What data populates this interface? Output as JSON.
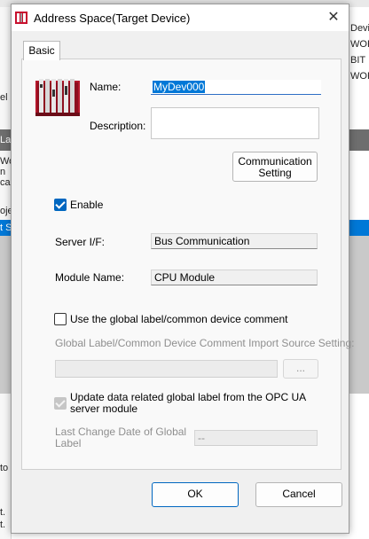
{
  "background": {
    "right_texts": [
      "Devi",
      "WOR",
      "BIT",
      "WOR"
    ],
    "left_texts": [
      "el (",
      "Lab",
      "Wor",
      "n",
      "ca",
      "oje",
      "t S",
      "to",
      "t.",
      "t."
    ]
  },
  "dialog": {
    "title": "Address Space(Target Device)",
    "close_glyph": "✕",
    "tab_label": "Basic",
    "name_label": "Name:",
    "name_value": "MyDev000",
    "description_label": "Description:",
    "description_value": "",
    "comm_button_line1": "Communication",
    "comm_button_line2": "Setting",
    "enable_label": "Enable",
    "enable_checked": true,
    "server_if_label": "Server I/F:",
    "server_if_value": "Bus Communication",
    "module_name_label": "Module Name:",
    "module_name_value": "CPU Module",
    "global_label_checkbox": "Use the global label/common device comment",
    "global_label_checked": false,
    "import_source_label": "Global Label/Common Device Comment Import Source Setting:",
    "import_source_value": "",
    "browse_label": "...",
    "update_label_line1": "Update data related global label from the OPC UA",
    "update_label_line2": "server module",
    "update_checked": true,
    "last_change_line1": "Last Change Date of Global",
    "last_change_line2": "Label",
    "last_change_value": "--",
    "ok_label": "OK",
    "cancel_label": "Cancel"
  },
  "colors": {
    "accent": "#0067c0",
    "selection": "#0078d7"
  }
}
